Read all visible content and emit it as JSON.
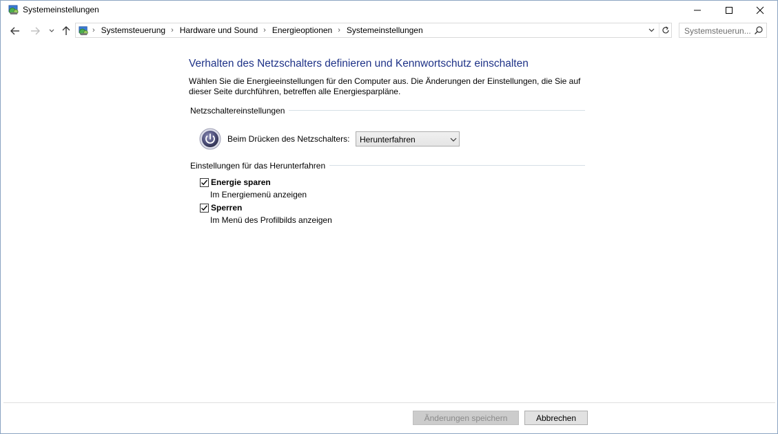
{
  "window": {
    "title": "Systemeinstellungen"
  },
  "address_bar": {
    "breadcrumbs": [
      "Systemsteuerung",
      "Hardware und Sound",
      "Energieoptionen",
      "Systemeinstellungen"
    ],
    "search_placeholder": "Systemsteuerun..."
  },
  "main": {
    "heading": "Verhalten des Netzschalters definieren und Kennwortschutz einschalten",
    "intro": "Wählen Sie die Energieeinstellungen für den Computer aus. Die Änderungen der Einstellungen, die Sie auf dieser Seite durchführen, betreffen alle Energiesparpläne.",
    "power_group": {
      "title": "Netzschaltereinstellungen",
      "power_button_label": "Beim Drücken des Netzschalters:",
      "power_button_value": "Herunterfahren"
    },
    "shutdown_group": {
      "title": "Einstellungen für das Herunterfahren",
      "options": [
        {
          "label": "Energie sparen",
          "description": "Im Energiemenü anzeigen",
          "checked": true
        },
        {
          "label": "Sperren",
          "description": "Im Menü des Profilbilds anzeigen",
          "checked": true
        }
      ]
    }
  },
  "footer": {
    "save_label": "Änderungen speichern",
    "save_enabled": false,
    "cancel_label": "Abbrechen"
  },
  "colors": {
    "heading": "#1e3287",
    "window_border": "#8aa3c1"
  }
}
